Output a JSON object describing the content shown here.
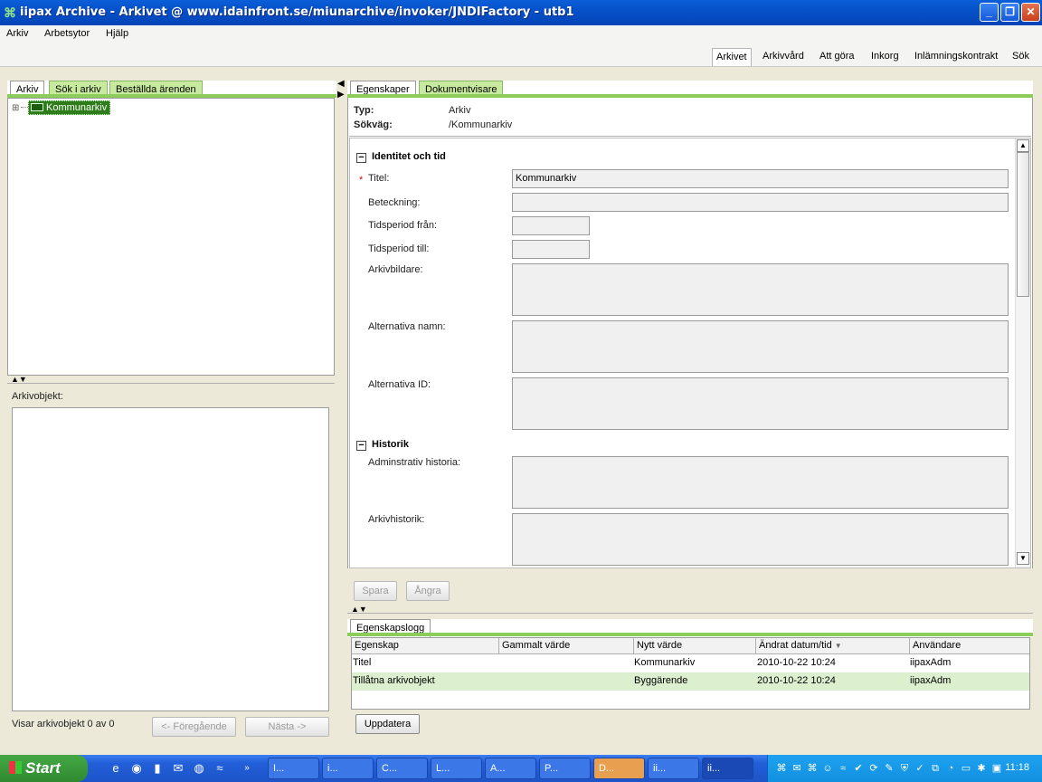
{
  "window": {
    "title": "iipax Archive - Arkivet @ www.idainfront.se/miunarchive/invoker/JNDIFactory - utb1",
    "minimize": "_",
    "maximize": "❐",
    "close": "✕"
  },
  "menu": {
    "items": [
      "Arkiv",
      "Arbetsytor",
      "Hjälp"
    ]
  },
  "top_tabs": [
    "Arkivet",
    "Arkivvård",
    "Att göra",
    "Inkorg",
    "Inlämningskontrakt",
    "Sök"
  ],
  "left": {
    "tabs": [
      "Arkiv",
      "Sök i arkiv",
      "Beställda ärenden"
    ],
    "tree": {
      "expander": "⊞",
      "root_label": "Kommunarkiv"
    },
    "objects_label": "Arkivobjekt:",
    "status": "Visar arkivobjekt 0 av 0",
    "prev_button": "<- Föregående",
    "next_button": "Nästa ->"
  },
  "right": {
    "tabs": [
      "Egenskaper",
      "Dokumentvisare"
    ],
    "typ_label": "Typ:",
    "typ_value": "Arkiv",
    "sokvag_label": "Sökväg:",
    "sokvag_value": "/Kommunarkiv",
    "section1_title": "Identitet och tid",
    "section2_title": "Historik",
    "required_mark": "*",
    "fields": {
      "titel_label": "Titel:",
      "titel_value": "Kommunarkiv",
      "beteckning_label": "Beteckning:",
      "tidsperiod_fran_label": "Tidsperiod från:",
      "tidsperiod_till_label": "Tidsperiod till:",
      "arkivbildare_label": "Arkivbildare:",
      "alternativa_namn_label": "Alternativa namn:",
      "alternativa_id_label": "Alternativa ID:",
      "adm_historia_label": "Adminstrativ historia:",
      "arkivhistorik_label": "Arkivhistorik:"
    },
    "save_button": "Spara",
    "undo_button": "Ångra",
    "log": {
      "tab": "Egenskapslogg",
      "columns": [
        "Egenskap",
        "Gammalt värde",
        "Nytt värde",
        "Ändrat datum/tid",
        "Användare"
      ],
      "rows": [
        [
          "Titel",
          "",
          "Kommunarkiv",
          "2010-10-22 10:24",
          "iipaxAdm"
        ],
        [
          "Tillåtna arkivobjekt",
          "",
          "Byggärende",
          "2010-10-22 10:24",
          "iipaxAdm"
        ]
      ],
      "update_button": "Uppdatera"
    }
  },
  "taskbar": {
    "start": "Start",
    "items": [
      "I...",
      "i...",
      "C...",
      "L...",
      "A...",
      "P...",
      "D...",
      "ii...",
      "ii..."
    ],
    "clock": "11:18"
  }
}
